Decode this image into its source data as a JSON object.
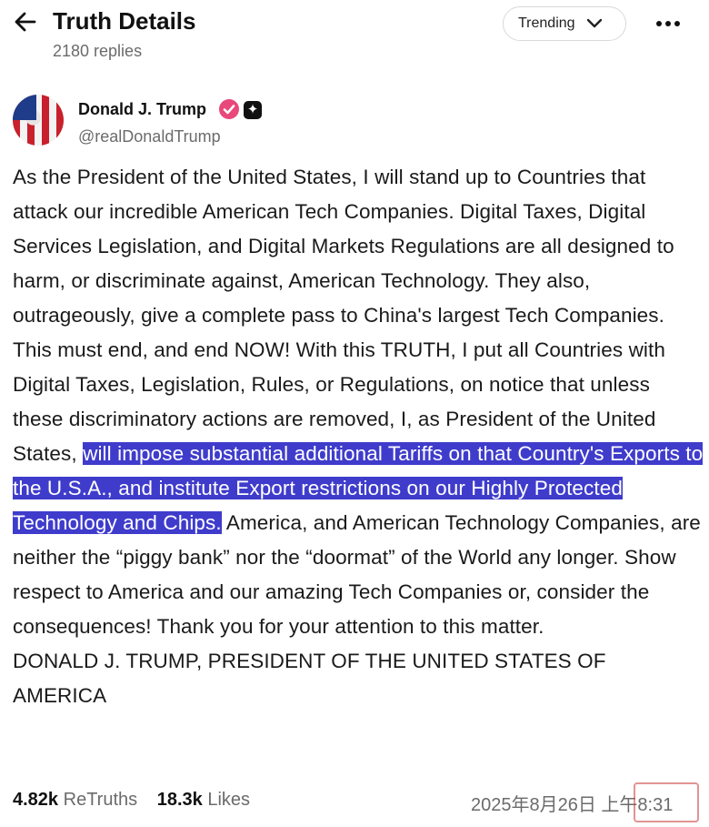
{
  "header": {
    "title": "Truth Details",
    "replies": "2180 replies",
    "sort_label": "Trending"
  },
  "author": {
    "name": "Donald J. Trump",
    "badge": "✦",
    "handle": "@realDonaldTrump"
  },
  "post": {
    "text_before": "As the President of the United States, I will stand up to Countries that attack our incredible American Tech Companies. Digital Taxes, Digital Services Legislation, and Digital Markets Regulations are all designed to harm, or discriminate against, American Technology. They also, outrageously, give a complete pass to China's largest Tech Companies. This must end, and end NOW! With this TRUTH, I put all Countries with Digital Taxes, Legislation, Rules, or Regulations, on notice that unless these discriminatory actions are removed, I, as President of the United States, ",
    "text_highlighted": "will impose substantial additional Tariffs on that Country's Exports to the U.S.A., and institute Export restrictions on our Highly Protected Technology and Chips.",
    "text_after": " America, and American Technology Companies, are neither the “piggy bank” nor the “doormat” of the World any longer. Show respect to America and our amazing Tech Companies or, consider the consequences! Thank you for your attention to this matter.",
    "signature": "DONALD J. TRUMP, PRESIDENT OF THE UNITED STATES OF AMERICA"
  },
  "stats": {
    "retruths_count": "4.82k",
    "retruths_label": "ReTruths",
    "likes_count": "18.3k",
    "likes_label": "Likes",
    "timestamp": "2025年8月26日 上午8:31"
  },
  "colors": {
    "highlight": "#3f3ccc",
    "verified": "#e8487a",
    "muted_text": "#6b6b6b"
  }
}
